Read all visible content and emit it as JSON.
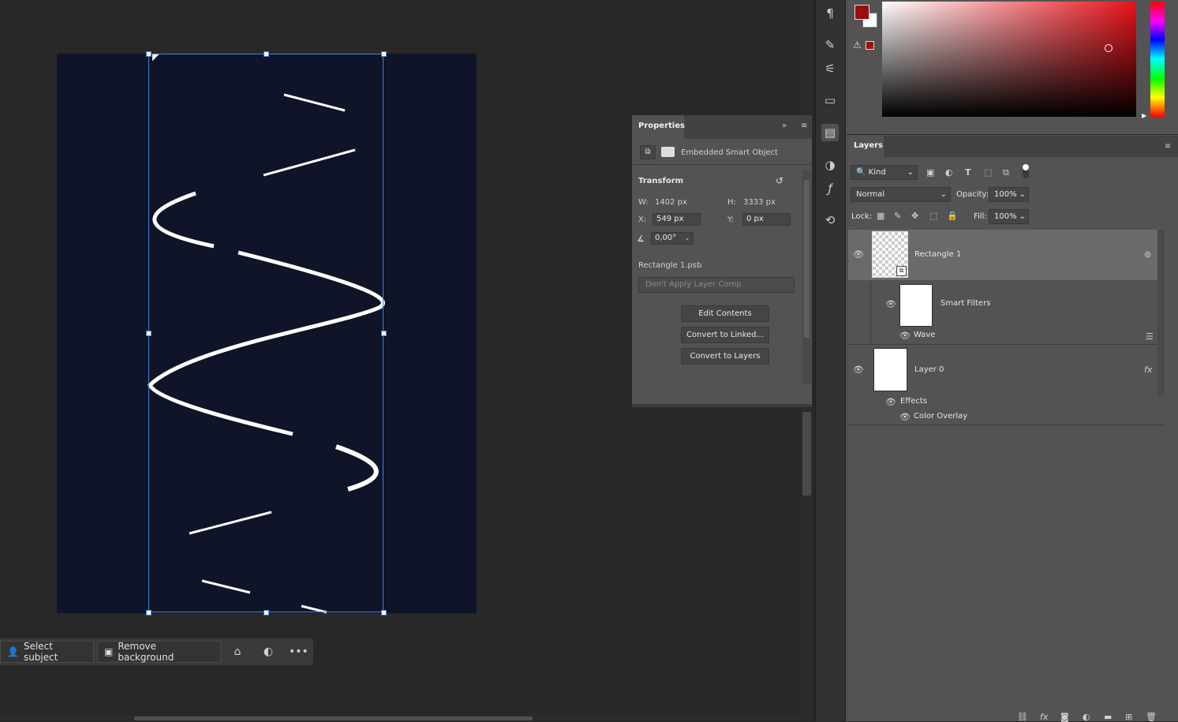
{
  "task_bar": {
    "select_subject": "Select subject",
    "remove_background": "Remove background"
  },
  "properties": {
    "tab": "Properties",
    "object_type": "Embedded Smart Object",
    "section": "Transform",
    "w_label": "W:",
    "w_value": "1402 px",
    "h_label": "H:",
    "h_value": "3333 px",
    "x_label": "X:",
    "x_value": "549 px",
    "y_label": "Y:",
    "y_value": "0 px",
    "angle_value": "0,00°",
    "filename": "Rectangle 1.psb",
    "layer_comp": "Don't Apply Layer Comp",
    "edit_contents": "Edit Contents",
    "convert_linked": "Convert to Linked...",
    "convert_layers": "Convert to Layers"
  },
  "color": {
    "foreground": "#9b0e0e",
    "background": "#ffffff"
  },
  "layers": {
    "tab": "Layers",
    "kind": "Kind",
    "blend_mode": "Normal",
    "opacity_label": "Opacity:",
    "opacity_value": "100%",
    "lock_label": "Lock:",
    "fill_label": "Fill:",
    "fill_value": "100%",
    "items": [
      {
        "name": "Rectangle 1"
      },
      {
        "name": "Smart Filters"
      },
      {
        "name": "Wave"
      },
      {
        "name": "Layer 0"
      },
      {
        "name": "Effects"
      },
      {
        "name": "Color Overlay"
      }
    ]
  }
}
